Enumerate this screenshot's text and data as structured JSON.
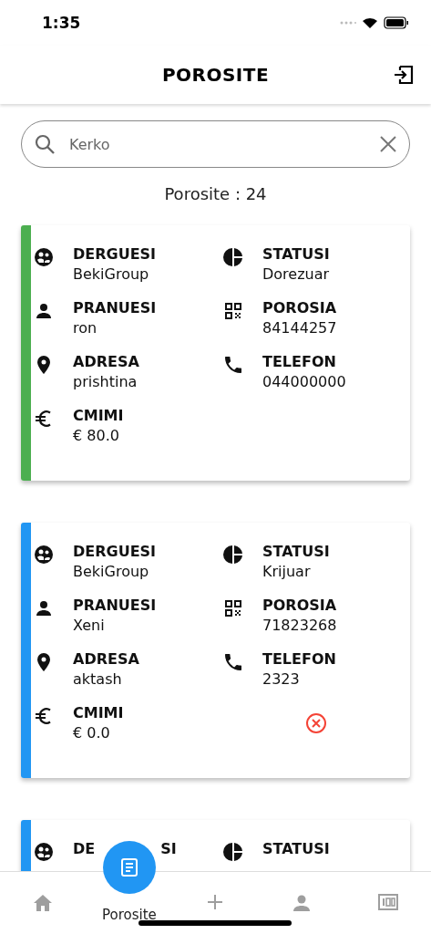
{
  "status_bar": {
    "time": "1:35"
  },
  "header": {
    "title": "POROSITE"
  },
  "search": {
    "placeholder": "Kerko"
  },
  "count": "Porosite : 24",
  "orders": [
    {
      "color": "#4caf50",
      "cancel_button": false,
      "fields": [
        {
          "kind": "sender",
          "label": "DERGUESI",
          "value": "BekiGroup"
        },
        {
          "kind": "status",
          "label": "STATUSI",
          "value": "Dorezuar"
        },
        {
          "kind": "receiver",
          "label": "PRANUESI",
          "value": "ron"
        },
        {
          "kind": "order",
          "label": "POROSIA",
          "value": "84144257"
        },
        {
          "kind": "address",
          "label": "ADRESA",
          "value": "prishtina"
        },
        {
          "kind": "phone",
          "label": "TELEFON",
          "value": "044000000"
        },
        {
          "kind": "price",
          "label": "CMIMI",
          "value": "€ 80.0"
        }
      ]
    },
    {
      "color": "#2196f3",
      "cancel_button": true,
      "fields": [
        {
          "kind": "sender",
          "label": "DERGUESI",
          "value": "BekiGroup"
        },
        {
          "kind": "status",
          "label": "STATUSI",
          "value": "Krijuar"
        },
        {
          "kind": "receiver",
          "label": "PRANUESI",
          "value": "Xeni"
        },
        {
          "kind": "order",
          "label": "POROSIA",
          "value": "71823268"
        },
        {
          "kind": "address",
          "label": "ADRESA",
          "value": "aktash"
        },
        {
          "kind": "phone",
          "label": "TELEFON",
          "value": "2323"
        },
        {
          "kind": "price",
          "label": "CMIMI",
          "value": "€ 0.0"
        }
      ]
    },
    {
      "color": "#2196f3",
      "cancel_button": false,
      "fields": [
        {
          "kind": "sender",
          "label": "DE",
          "label_end": "SI"
        },
        {
          "kind": "status",
          "label": "STATUSI"
        }
      ]
    }
  ],
  "nav": [
    {
      "kind": "home",
      "selected": false
    },
    {
      "kind": "orders",
      "label": "Porosite",
      "selected": true
    },
    {
      "kind": "add",
      "selected": false
    },
    {
      "kind": "user",
      "selected": false
    },
    {
      "kind": "counter",
      "selected": false
    }
  ]
}
